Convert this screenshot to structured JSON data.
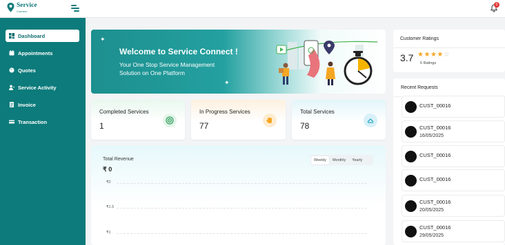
{
  "brand": {
    "name": "Service",
    "tagline": "Connect",
    "color": "#137a7a"
  },
  "header": {
    "notification_count": "0"
  },
  "sidebar": {
    "items": [
      {
        "label": "Dashboard",
        "icon": "dashboard-icon",
        "active": true
      },
      {
        "label": "Appointments",
        "icon": "calendar-icon"
      },
      {
        "label": "Quotes",
        "icon": "quote-icon"
      },
      {
        "label": "Service Activity",
        "icon": "user-activity-icon"
      },
      {
        "label": "Invoice",
        "icon": "invoice-icon"
      },
      {
        "label": "Transaction",
        "icon": "transaction-icon"
      }
    ]
  },
  "welcome": {
    "title": "Welcome to Service Connect !",
    "subtitle": "Your One Stop Service Management Solution on One Platform"
  },
  "stats": [
    {
      "label": "Completed Services",
      "value": "1",
      "icon": "target-icon",
      "color": "#2e9e5a"
    },
    {
      "label": "In Progress Services",
      "value": "77",
      "icon": "hand-icon",
      "color": "#f5a623"
    },
    {
      "label": "Total Services",
      "value": "78",
      "icon": "service-icon",
      "color": "#2ba7c4"
    }
  ],
  "revenue": {
    "title": "Total Revenue",
    "value": "₹ 0",
    "tabs": [
      {
        "label": "Weekly",
        "active": true
      },
      {
        "label": "Monthly"
      },
      {
        "label": "Yearly"
      }
    ],
    "ticks": [
      "₹2",
      "₹1.5",
      "₹1"
    ]
  },
  "ratings": {
    "title": "Customer Ratings",
    "value": "3.7",
    "rating": 3.7,
    "max": 5,
    "count_label": "6 Ratings"
  },
  "requests": {
    "title": "Recent Requests",
    "items": [
      {
        "name": "CUST_00016",
        "date": ""
      },
      {
        "name": "CUST_00016",
        "date": "16/05/2025"
      },
      {
        "name": "CUST_00016",
        "date": ""
      },
      {
        "name": "CUST_00016",
        "date": ""
      },
      {
        "name": "CUST_00016",
        "date": "20/05/2025"
      },
      {
        "name": "CUST_00016",
        "date": "29/05/2025"
      }
    ]
  },
  "colors": {
    "sidebar": "#0d7b7b",
    "accent": "#137a7a",
    "badge": "#e53935",
    "star": "#f5a623"
  }
}
